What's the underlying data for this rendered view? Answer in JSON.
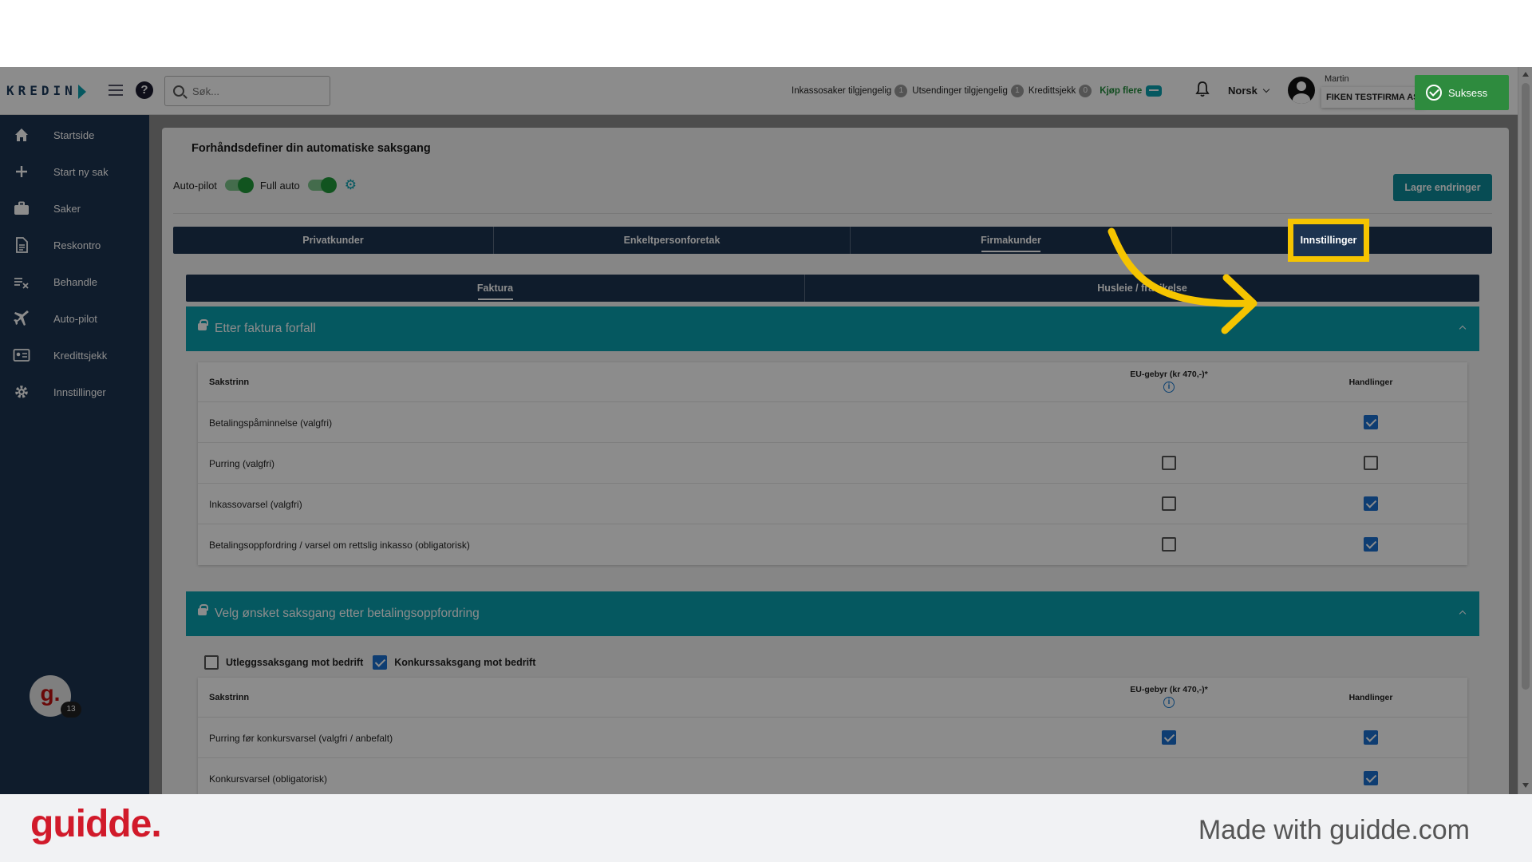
{
  "header": {
    "logo_text": "KREDIN",
    "search_placeholder": "Søk...",
    "quotas": [
      {
        "label": "Inkassosaker tilgjengelig",
        "count": "1"
      },
      {
        "label": "Utsendinger tilgjengelig",
        "count": "1"
      },
      {
        "label": "Kredittsjekk",
        "count": "0"
      }
    ],
    "buy_more": "Kjøp flere",
    "language": "Norsk",
    "user_name": "Martin",
    "company": "FIKEN TESTFIRMA AS"
  },
  "toast": {
    "label": "Suksess"
  },
  "sidebar": {
    "items": [
      {
        "label": "Startside",
        "icon": "home-icon"
      },
      {
        "label": "Start ny sak",
        "icon": "plus-icon"
      },
      {
        "label": "Saker",
        "icon": "briefcase-icon"
      },
      {
        "label": "Reskontro",
        "icon": "document-icon"
      },
      {
        "label": "Behandle",
        "icon": "checklist-icon"
      },
      {
        "label": "Auto-pilot",
        "icon": "airplane-icon"
      },
      {
        "label": "Kredittsjekk",
        "icon": "id-card-icon"
      },
      {
        "label": "Innstillinger",
        "icon": "gear-icon"
      }
    ],
    "avatar_letter": "g.",
    "avatar_badge": "13"
  },
  "main": {
    "title": "Forhåndsdefiner din automatiske saksgang",
    "toggle_autopilot": "Auto-pilot",
    "toggle_fullauto": "Full auto",
    "save_label": "Lagre endringer",
    "tabs": [
      {
        "label": "Privatkunder"
      },
      {
        "label": "Enkeltpersonforetak"
      },
      {
        "label": "Firmakunder",
        "active": true
      },
      {
        "label": "Innstillinger",
        "highlighted": true
      }
    ],
    "subtabs": [
      {
        "label": "Faktura",
        "active": true
      },
      {
        "label": "Husleie / fravikelse"
      }
    ],
    "section1": {
      "title": "Etter faktura forfall",
      "col_name": "Sakstrinn",
      "col_eu": "EU-gebyr (kr 470,-)*",
      "col_actions": "Handlinger",
      "rows": [
        {
          "name": "Betalingspåminnelse (valgfri)",
          "eu": null,
          "action": true
        },
        {
          "name": "Purring (valgfri)",
          "eu": false,
          "action": false
        },
        {
          "name": "Inkassovarsel (valgfri)",
          "eu": false,
          "action": true
        },
        {
          "name": "Betalingsoppfordring / varsel om rettslig inkasso (obligatorisk)",
          "eu": false,
          "action": true
        }
      ]
    },
    "section2": {
      "title": "Velg ønsket saksgang etter betalingsoppfordring",
      "option_utlegg": "Utleggssaksgang mot bedrift",
      "option_utlegg_checked": false,
      "option_konkurs": "Konkurssaksgang mot bedrift",
      "option_konkurs_checked": true,
      "col_name": "Sakstrinn",
      "col_eu": "EU-gebyr (kr 470,-)*",
      "col_actions": "Handlinger",
      "rows": [
        {
          "name": "Purring før konkursvarsel (valgfri / anbefalt)",
          "eu": true,
          "action": true
        },
        {
          "name": "Konkursvarsel (obligatorisk)",
          "eu": null,
          "action": true
        }
      ]
    }
  },
  "footer": {
    "brand": "guidde.",
    "made_with": "Made with guidde.com"
  },
  "colors": {
    "sidebar": "#1c3350",
    "teal": "#0aa0b0",
    "highlight": "#f5c400",
    "success": "#2e8b3e",
    "checkbox": "#1a6fd0"
  }
}
